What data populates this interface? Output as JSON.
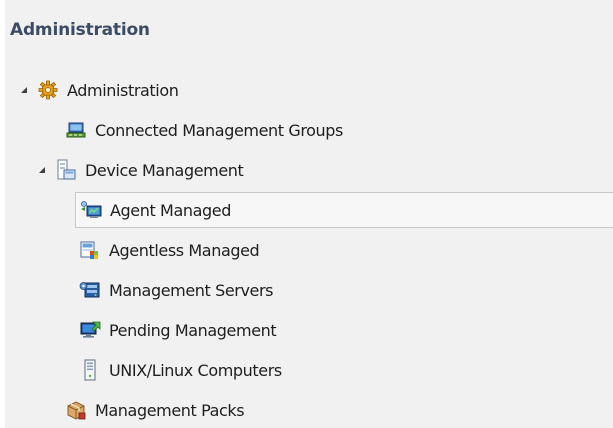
{
  "pane": {
    "header": "Administration"
  },
  "tree": {
    "admin_root": {
      "label": "Administration",
      "icon": "gear-icon",
      "expanded": true
    },
    "connected_groups": {
      "label": "Connected Management Groups",
      "icon": "network-group-icon"
    },
    "device_management": {
      "label": "Device Management",
      "icon": "device-list-icon",
      "expanded": true
    },
    "agent_managed": {
      "label": "Agent Managed",
      "icon": "agent-computer-icon",
      "selected": true
    },
    "agentless_managed": {
      "label": "Agentless Managed",
      "icon": "agentless-computer-icon"
    },
    "management_servers": {
      "label": "Management Servers",
      "icon": "server-icon"
    },
    "pending_management": {
      "label": "Pending Management",
      "icon": "pending-monitor-icon"
    },
    "unix_linux": {
      "label": "UNIX/Linux Computers",
      "icon": "tower-computer-icon"
    },
    "management_packs": {
      "label": "Management Packs",
      "icon": "package-icon"
    }
  },
  "colors": {
    "pane_background": "#f1f1f1",
    "header_text": "#3c4c64",
    "item_text": "#1e1e1e",
    "selection_background": "#f7f7f7",
    "selection_border": "#c9c9c9"
  }
}
